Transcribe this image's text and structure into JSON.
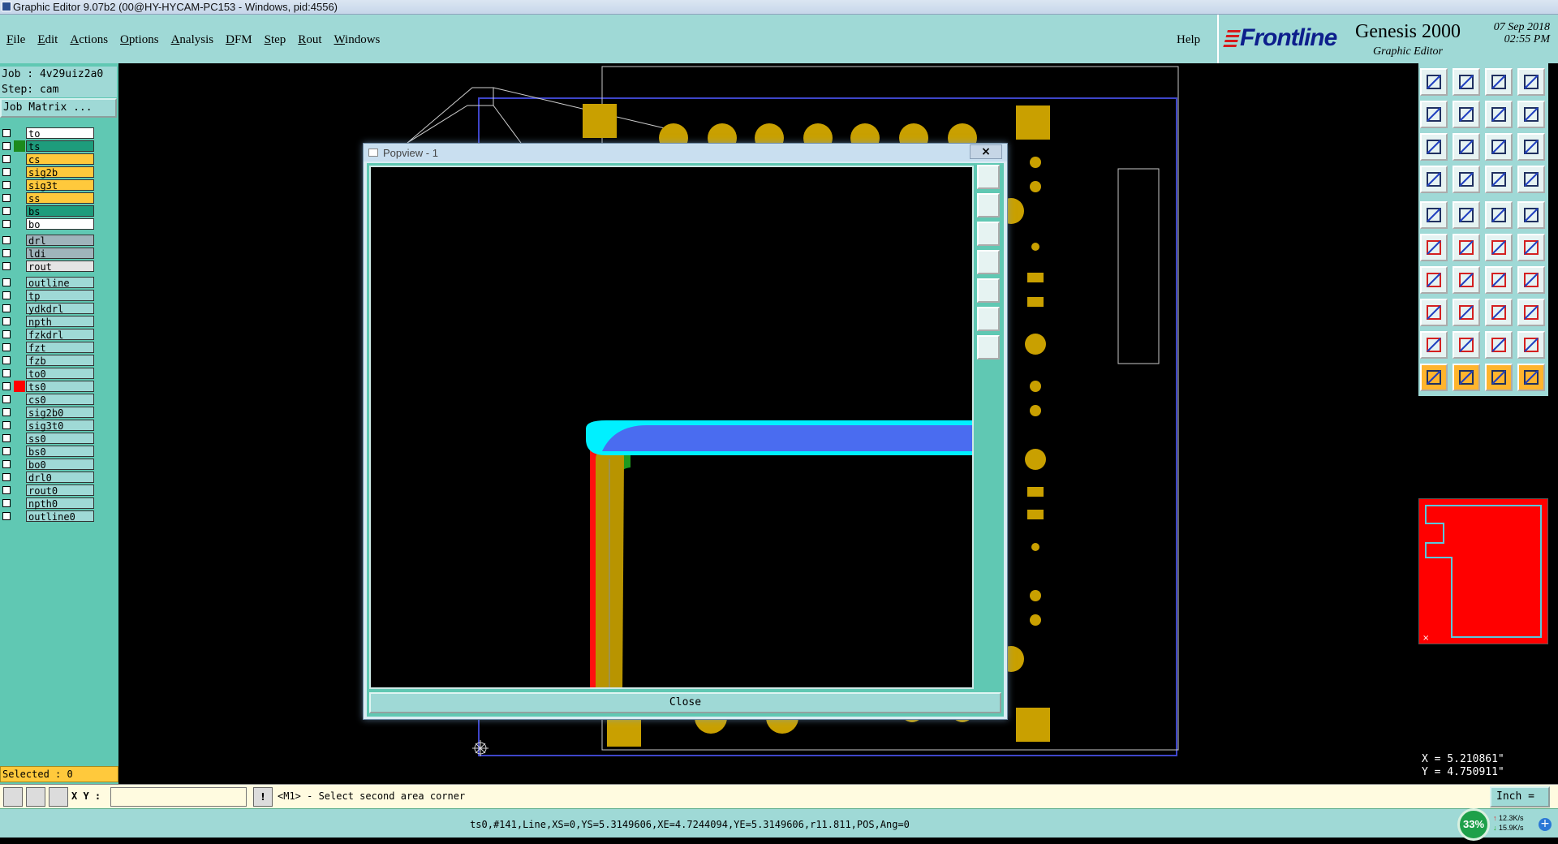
{
  "window": {
    "title": "Graphic Editor 9.07b2 (00@HY-HYCAM-PC153 - Windows, pid:4556)"
  },
  "menu": {
    "items": [
      "File",
      "Edit",
      "Actions",
      "Options",
      "Analysis",
      "DFM",
      "Step",
      "Rout",
      "Windows"
    ],
    "help": "Help"
  },
  "brand": {
    "logo": "Frontline",
    "product": "Genesis 2000",
    "subtitle": "Graphic Editor",
    "date": "07 Sep 2018",
    "time": "02:55 PM"
  },
  "job": {
    "job": "Job : 4v29uiz2a0",
    "step": "Step: cam",
    "matrix_button": "Job Matrix ..."
  },
  "layers": {
    "group1": [
      {
        "name": "to",
        "bg": "#ffffff",
        "swatch": ""
      },
      {
        "name": "ts",
        "bg": "#1e9c7c",
        "swatch": "#1c8a1c"
      },
      {
        "name": "cs",
        "bg": "#ffc93c",
        "swatch": ""
      },
      {
        "name": "sig2b",
        "bg": "#ffc93c",
        "swatch": ""
      },
      {
        "name": "sig3t",
        "bg": "#ffc93c",
        "swatch": ""
      },
      {
        "name": "ss",
        "bg": "#ffc93c",
        "swatch": ""
      },
      {
        "name": "bs",
        "bg": "#1e9c7c",
        "swatch": ""
      },
      {
        "name": "bo",
        "bg": "#ffffff",
        "swatch": ""
      }
    ],
    "group2": [
      {
        "name": "drl",
        "bg": "#9fb4bb",
        "swatch": ""
      },
      {
        "name": "ldi",
        "bg": "#9fb4bb",
        "swatch": ""
      },
      {
        "name": "rout",
        "bg": "#e4e4e4",
        "swatch": ""
      }
    ],
    "group3": [
      {
        "name": "outline",
        "bg": "#9fd9d6",
        "swatch": ""
      },
      {
        "name": "tp",
        "bg": "#9fd9d6",
        "swatch": ""
      },
      {
        "name": "ydkdrl",
        "bg": "#9fd9d6",
        "swatch": ""
      },
      {
        "name": "npth",
        "bg": "#9fd9d6",
        "swatch": ""
      },
      {
        "name": "fzkdrl",
        "bg": "#9fd9d6",
        "swatch": ""
      },
      {
        "name": "fzt",
        "bg": "#9fd9d6",
        "swatch": ""
      },
      {
        "name": "fzb",
        "bg": "#9fd9d6",
        "swatch": ""
      },
      {
        "name": "to0",
        "bg": "#9fd9d6",
        "swatch": ""
      },
      {
        "name": "ts0",
        "bg": "#9fd9d6",
        "swatch": "#ff0000"
      },
      {
        "name": "cs0",
        "bg": "#9fd9d6",
        "swatch": ""
      },
      {
        "name": "sig2b0",
        "bg": "#9fd9d6",
        "swatch": ""
      },
      {
        "name": "sig3t0",
        "bg": "#9fd9d6",
        "swatch": ""
      },
      {
        "name": "ss0",
        "bg": "#9fd9d6",
        "swatch": ""
      },
      {
        "name": "bs0",
        "bg": "#9fd9d6",
        "swatch": ""
      },
      {
        "name": "bo0",
        "bg": "#9fd9d6",
        "swatch": ""
      },
      {
        "name": "drl0",
        "bg": "#9fd9d6",
        "swatch": ""
      },
      {
        "name": "rout0",
        "bg": "#9fd9d6",
        "swatch": ""
      },
      {
        "name": "npth0",
        "bg": "#9fd9d6",
        "swatch": ""
      },
      {
        "name": "outline0",
        "bg": "#9fd9d6",
        "swatch": ""
      }
    ]
  },
  "selected": "Selected : 0",
  "popview": {
    "title": "Popview - 1",
    "close_x": "×",
    "close_button": "Close"
  },
  "coords": {
    "x": "X = 5.210861\"",
    "y": "Y = 4.750911\""
  },
  "input": {
    "xy_label": "X Y :",
    "xy_value": "",
    "message": "<M1> - Select second area corner",
    "unit": "Inch ="
  },
  "status": "ts0,#141,Line,XS=0,YS=5.3149606,XE=4.7244094,YE=5.3149606,r11.811,POS,Ang=0",
  "net": {
    "percent": "33%",
    "up": "12.3K/s",
    "down": "15.9K/s"
  },
  "colors": {
    "panel": "#9fd9d6",
    "panel_dark": "#60c8b3",
    "pad": "#c9a000",
    "highlight": "#ffc93c"
  }
}
